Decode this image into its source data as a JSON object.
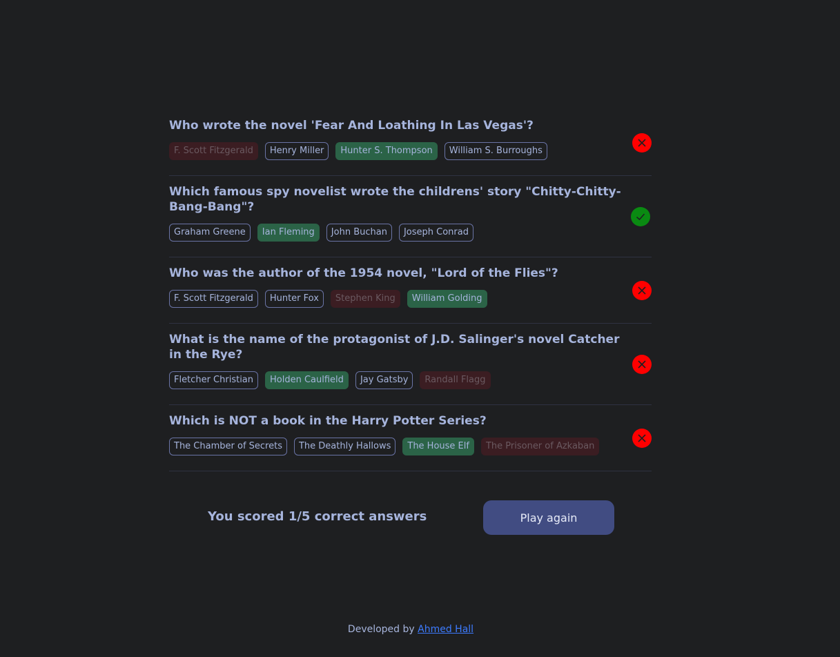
{
  "questions": [
    {
      "text": "Who wrote the novel 'Fear And Loathing In Las Vegas'?",
      "options": [
        {
          "label": "F. Scott Fitzgerald",
          "state": "wrong"
        },
        {
          "label": "Henry Miller",
          "state": "neutral"
        },
        {
          "label": "Hunter S. Thompson",
          "state": "correct"
        },
        {
          "label": "William S. Burroughs",
          "state": "neutral"
        }
      ],
      "result": "incorrect"
    },
    {
      "text": "Which famous spy novelist wrote the childrens' story \"Chitty-Chitty-Bang-Bang\"?",
      "options": [
        {
          "label": "Graham Greene",
          "state": "neutral"
        },
        {
          "label": "Ian Fleming",
          "state": "correct"
        },
        {
          "label": "John Buchan",
          "state": "neutral"
        },
        {
          "label": "Joseph Conrad",
          "state": "neutral"
        }
      ],
      "result": "correct"
    },
    {
      "text": "Who was the author of the 1954 novel, \"Lord of the Flies\"?",
      "options": [
        {
          "label": "F. Scott Fitzgerald",
          "state": "neutral"
        },
        {
          "label": "Hunter Fox",
          "state": "neutral"
        },
        {
          "label": "Stephen King",
          "state": "wrong"
        },
        {
          "label": "William Golding",
          "state": "correct"
        }
      ],
      "result": "incorrect"
    },
    {
      "text": "What is the name of the protagonist of J.D. Salinger's novel Catcher in the Rye?",
      "options": [
        {
          "label": "Fletcher Christian",
          "state": "neutral"
        },
        {
          "label": "Holden Caulfield",
          "state": "correct"
        },
        {
          "label": "Jay Gatsby",
          "state": "neutral"
        },
        {
          "label": "Randall Flagg",
          "state": "wrong"
        }
      ],
      "result": "incorrect"
    },
    {
      "text": "Which is NOT a book in the Harry Potter Series?",
      "options": [
        {
          "label": "The Chamber of Secrets",
          "state": "neutral"
        },
        {
          "label": "The Deathly Hallows",
          "state": "neutral"
        },
        {
          "label": "The House Elf",
          "state": "correct"
        },
        {
          "label": "The Prisoner of Azkaban",
          "state": "wrong"
        }
      ],
      "result": "incorrect"
    }
  ],
  "score_text": "You scored 1/5 correct answers",
  "play_again_label": "Play again",
  "credit": {
    "prefix": "Developed by",
    "author": "Ahmed Hall"
  },
  "colors": {
    "background": "#1e1f21",
    "text": "#a6b4dc",
    "correct": "#2b6347",
    "wrong": "#3b1d22",
    "status_wrong": "#ff0000",
    "status_right": "#0a8a12",
    "button": "#414c82",
    "link": "#3d7bff"
  }
}
